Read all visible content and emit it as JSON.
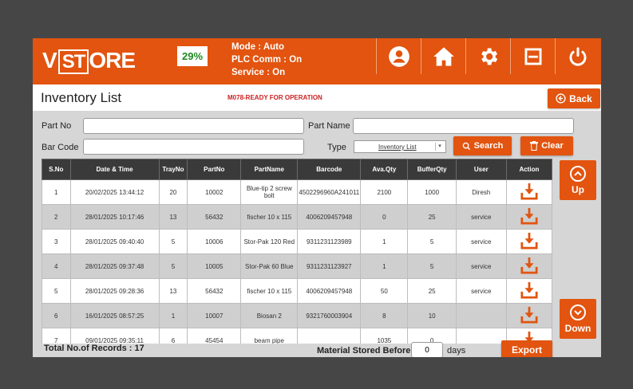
{
  "header": {
    "logo_text": "VSTORE",
    "percentage": "29%",
    "mode": "Mode : Auto",
    "plc_comm": "PLC Comm : On",
    "service": "Service : On",
    "colors": {
      "accent": "#e2540f",
      "percent_text": "#1e8a1e"
    },
    "icons": [
      "user-icon",
      "home-icon",
      "gear-icon",
      "minimize-icon",
      "power-icon"
    ]
  },
  "page": {
    "title": "Inventory List",
    "status_message": "M078-READY FOR OPERATION",
    "back_label": "Back"
  },
  "filters": {
    "part_no_label": "Part No",
    "part_no_value": "",
    "part_name_label": "Part Name",
    "part_name_value": "",
    "bar_code_label": "Bar Code",
    "bar_code_value": "",
    "type_label": "Type",
    "type_value": "Inventory List",
    "search_label": "Search",
    "clear_label": "Clear"
  },
  "table": {
    "columns": [
      "S.No",
      "Date & Time",
      "TrayNo",
      "PartNo",
      "PartName",
      "Barcode",
      "Ava.Qty",
      "BufferQty",
      "User",
      "Action"
    ],
    "rows": [
      [
        "1",
        "20/02/2025 13:44:12",
        "20",
        "10002",
        "Blue-tip 2 screw bolt",
        "4502296960A241011",
        "2100",
        "1000",
        "Diresh"
      ],
      [
        "2",
        "28/01/2025 10:17:46",
        "13",
        "56432",
        "fischer 10 x 115",
        "4006209457948",
        "0",
        "25",
        "service"
      ],
      [
        "3",
        "28/01/2025 09:40:40",
        "5",
        "10006",
        "Stor-Pak 120 Red",
        "9311231123989",
        "1",
        "5",
        "service"
      ],
      [
        "4",
        "28/01/2025 09:37:48",
        "5",
        "10005",
        "Stor-Pak 60 Blue",
        "9311231123927",
        "1",
        "5",
        "service"
      ],
      [
        "5",
        "28/01/2025 09:28:36",
        "13",
        "56432",
        "fischer 10 x 115",
        "4006209457948",
        "50",
        "25",
        "service"
      ],
      [
        "6",
        "16/01/2025 08:57:25",
        "1",
        "10007",
        "Biosan 2",
        "9321760003904",
        "8",
        "10",
        ""
      ],
      [
        "7",
        "09/01/2025 09:35:11",
        "6",
        "45454",
        "beam pipe",
        "",
        "1035",
        "0",
        ""
      ]
    ],
    "action_icon": "download-icon"
  },
  "side": {
    "up_label": "Up",
    "down_label": "Down"
  },
  "footer": {
    "total_records": "Total No.of Records : 17",
    "material_stored_label": "Material Stored Before",
    "days_value": "0",
    "days_label": "days",
    "export_label": "Export"
  }
}
